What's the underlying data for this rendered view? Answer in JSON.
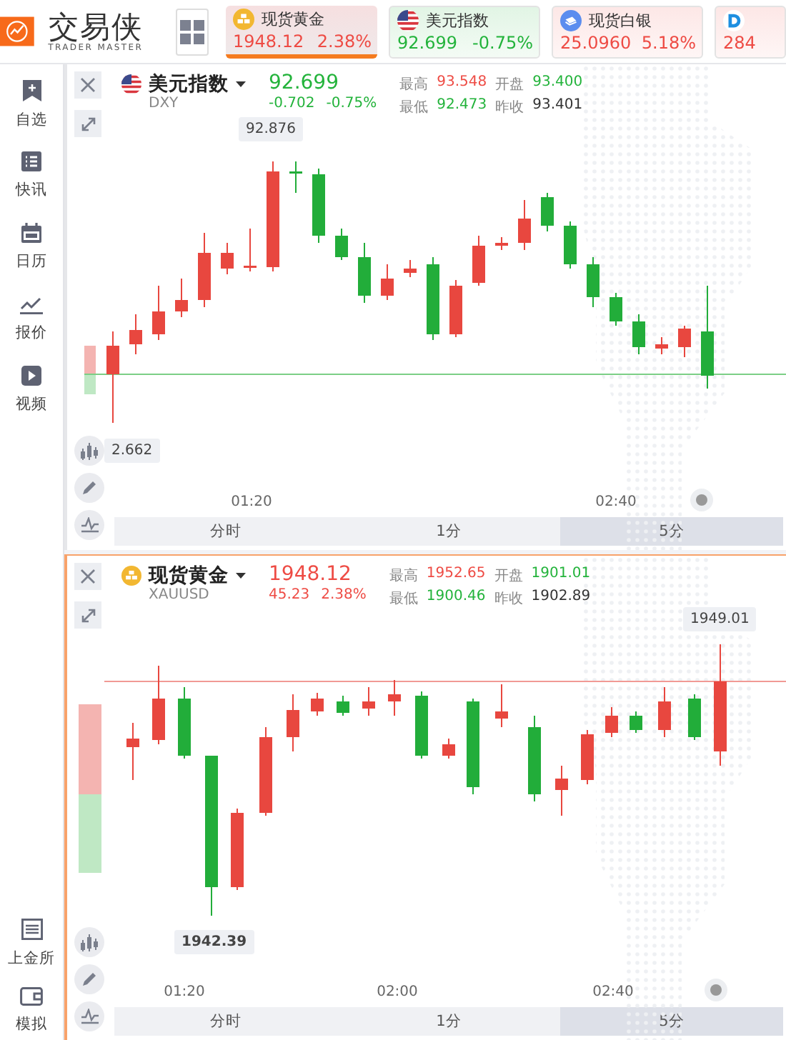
{
  "header": {
    "logo": {
      "name": "交易侠",
      "tagline": "TRADER MASTER"
    },
    "tickers": [
      {
        "kind": "gold",
        "name": "现货黄金",
        "price": "1948.12",
        "change": "2.38%",
        "color": "#ee4b44",
        "selected": true
      },
      {
        "kind": "flag",
        "name": "美元指数",
        "price": "92.699",
        "change": "-0.75%",
        "color": "#23b33b",
        "selected": false
      },
      {
        "kind": "silver",
        "name": "现货白银",
        "price": "25.0960",
        "change": "5.18%",
        "color": "#ee4b44",
        "selected": false
      },
      {
        "kind": "letter",
        "price": "284",
        "color": "#ee4b44",
        "selected": false
      }
    ]
  },
  "sidebar": {
    "items": [
      {
        "kind": "bookmark",
        "label": "自选"
      },
      {
        "kind": "list",
        "label": "快讯"
      },
      {
        "kind": "calendar",
        "label": "日历"
      },
      {
        "kind": "trend",
        "label": "报价"
      },
      {
        "kind": "play",
        "label": "视频"
      }
    ],
    "bottom_items": [
      {
        "kind": "sge",
        "label": "上金所"
      },
      {
        "kind": "wallet",
        "label": "模拟"
      }
    ]
  },
  "panels": [
    {
      "kind": "flag",
      "name": "美元指数",
      "code": "DXY",
      "price": "92.699",
      "change": "-0.702",
      "change_pct": "-0.75%",
      "color": "#23b33b",
      "selected": false,
      "stats": [
        {
          "label": "最高",
          "value": "93.548",
          "color": "#ee4b44"
        },
        {
          "label": "开盘",
          "value": "93.400",
          "color": "#23b33b"
        },
        {
          "label": "最低",
          "value": "92.473",
          "color": "#23b33b"
        },
        {
          "label": "昨收",
          "value": "93.401",
          "color": "#333333"
        }
      ],
      "high_label": "92.876",
      "low_label": "2.662",
      "time_labels": [
        "01:20",
        "02:40"
      ],
      "periods": [
        {
          "label": "分时",
          "selected": false
        },
        {
          "label": "1分",
          "selected": false
        },
        {
          "label": "5分",
          "selected": true
        }
      ]
    },
    {
      "kind": "gold",
      "name": "现货黄金",
      "code": "XAUUSD",
      "price": "1948.12",
      "change": "45.23",
      "change_pct": "2.38%",
      "color": "#ee4b44",
      "selected": true,
      "stats": [
        {
          "label": "最高",
          "value": "1952.65",
          "color": "#ee4b44"
        },
        {
          "label": "开盘",
          "value": "1901.01",
          "color": "#23b33b"
        },
        {
          "label": "最低",
          "value": "1900.46",
          "color": "#23b33b"
        },
        {
          "label": "昨收",
          "value": "1902.89",
          "color": "#333333"
        }
      ],
      "high_label": "1949.01",
      "low_label": "1942.39",
      "time_labels": [
        "01:20",
        "02:00",
        "02:40"
      ],
      "periods": [
        {
          "label": "分时",
          "selected": false
        },
        {
          "label": "1分",
          "selected": false
        },
        {
          "label": "5分",
          "selected": true
        }
      ]
    }
  ]
}
